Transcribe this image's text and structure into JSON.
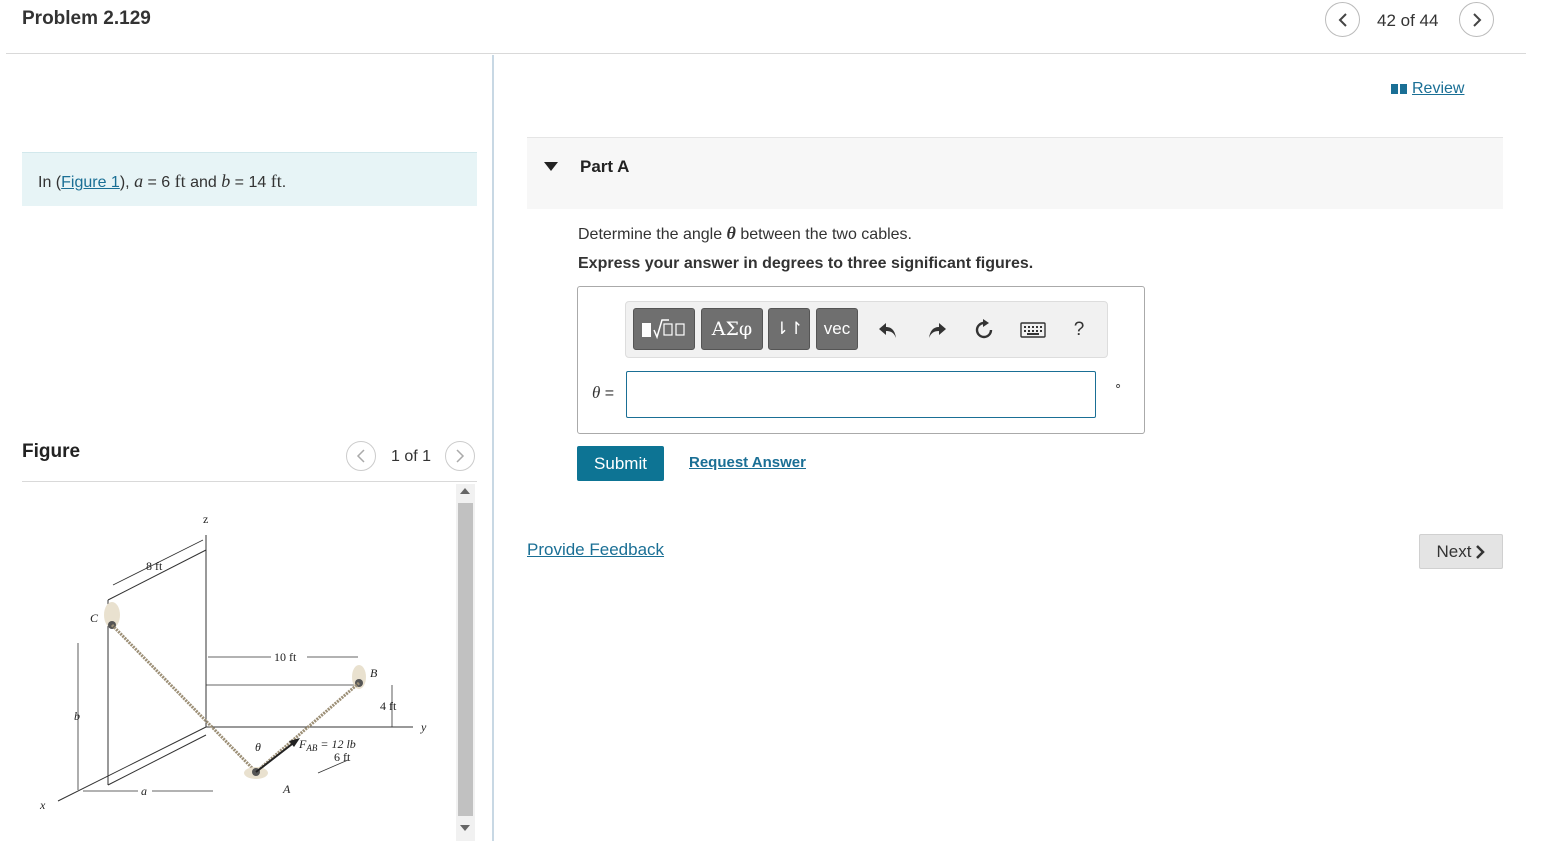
{
  "header": {
    "title": "Problem 2.129",
    "nav_count": "42 of 44",
    "prev_icon": "chevron-left-icon",
    "next_icon": "chevron-right-icon"
  },
  "intro": {
    "prefix": "In (",
    "figure_link": "Figure 1",
    "suffix": "),",
    "a_var": "a",
    "a_eq": " = 6 ",
    "a_unit": "ft",
    "and": " and ",
    "b_var": "b",
    "b_eq": " = 14 ",
    "b_unit": "ft",
    "end": "."
  },
  "figure": {
    "label": "Figure",
    "count": "1 of 1",
    "labels": {
      "z": "z",
      "c": "C",
      "dim_8ft": "8 ft",
      "dim_10ft": "10 ft",
      "b_point": "B",
      "dim_4ft": "4 ft",
      "y": "y",
      "b_dim": "b",
      "theta": "θ",
      "force": "F",
      "force_sub": "AB",
      "force_val": " = 12 lb",
      "dim_6ft": "6 ft",
      "a_point": "A",
      "a_dim": "a",
      "x": "x"
    }
  },
  "review": {
    "label": "Review",
    "icon": "book-icon"
  },
  "part": {
    "title": "Part A",
    "question_pre": "Determine the angle ",
    "question_var": "θ",
    "question_post": " between the two cables.",
    "instruction": "Express your answer in degrees to three significant figures.",
    "toolbar": {
      "templates_icon": "template-sqrt-icon",
      "greek": "ΑΣφ",
      "arrows": "⇂↾",
      "vec": "vec",
      "undo_icon": "undo-icon",
      "redo_icon": "redo-icon",
      "reset_icon": "reset-icon",
      "keyboard_icon": "keyboard-icon",
      "help": "?"
    },
    "answer_label_var": "θ",
    "answer_label_eq": " =",
    "answer_value": "",
    "unit": "∘",
    "submit": "Submit",
    "request": "Request Answer"
  },
  "footer": {
    "feedback": "Provide Feedback",
    "next": "Next"
  }
}
